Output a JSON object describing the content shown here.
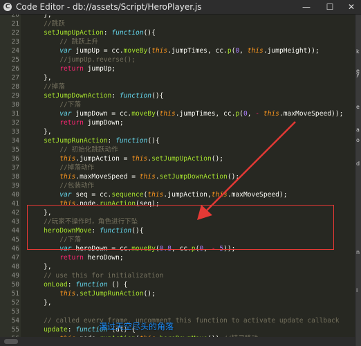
{
  "window": {
    "title": "Code Editor - db://assets/Script/HeroPlayer.js",
    "app_icon_glyph": "C",
    "minimize_glyph": "—",
    "maximize_glyph": "☐",
    "close_glyph": "✕"
  },
  "code": {
    "lines": [
      {
        "n": "20",
        "segs": [
          [
            "pl",
            "    },"
          ]
        ]
      },
      {
        "n": "21",
        "segs": [
          [
            "c",
            "    //跳跃"
          ]
        ]
      },
      {
        "n": "22",
        "segs": [
          [
            "pl",
            "    "
          ],
          [
            "fn",
            "setJumpUpAction"
          ],
          [
            "pl",
            ": "
          ],
          [
            "k",
            "function"
          ],
          [
            "pl",
            "(){"
          ]
        ]
      },
      {
        "n": "23",
        "segs": [
          [
            "c",
            "        // 跳跃上升"
          ]
        ]
      },
      {
        "n": "24",
        "segs": [
          [
            "pl",
            "        "
          ],
          [
            "k",
            "var"
          ],
          [
            "pl",
            " jumpUp = cc."
          ],
          [
            "fn",
            "moveBy"
          ],
          [
            "pl",
            "("
          ],
          [
            "t",
            "this"
          ],
          [
            "pl",
            ".jumpTimes, cc."
          ],
          [
            "fn",
            "p"
          ],
          [
            "pl",
            "("
          ],
          [
            "n",
            "0"
          ],
          [
            "pl",
            ", "
          ],
          [
            "t",
            "this"
          ],
          [
            "pl",
            ".jumpHeight));"
          ]
        ]
      },
      {
        "n": "25",
        "segs": [
          [
            "c",
            "        //jumpUp.reverse();"
          ]
        ]
      },
      {
        "n": "26",
        "segs": [
          [
            "pl",
            "        "
          ],
          [
            "kw",
            "return"
          ],
          [
            "pl",
            " jumpUp;"
          ]
        ]
      },
      {
        "n": "27",
        "segs": [
          [
            "pl",
            "    },"
          ]
        ]
      },
      {
        "n": "28",
        "segs": [
          [
            "c",
            "    //掉落"
          ]
        ]
      },
      {
        "n": "29",
        "segs": [
          [
            "pl",
            "    "
          ],
          [
            "fn",
            "setJumpDownAction"
          ],
          [
            "pl",
            ": "
          ],
          [
            "k",
            "function"
          ],
          [
            "pl",
            "(){"
          ]
        ]
      },
      {
        "n": "30",
        "segs": [
          [
            "c",
            "        //下落"
          ]
        ]
      },
      {
        "n": "31",
        "segs": [
          [
            "pl",
            "        "
          ],
          [
            "k",
            "var"
          ],
          [
            "pl",
            " jumpDown = cc."
          ],
          [
            "fn",
            "moveBy"
          ],
          [
            "pl",
            "("
          ],
          [
            "t",
            "this"
          ],
          [
            "pl",
            ".jumpTimes, cc."
          ],
          [
            "fn",
            "p"
          ],
          [
            "pl",
            "("
          ],
          [
            "n",
            "0"
          ],
          [
            "pl",
            ", "
          ],
          [
            "kw",
            "-"
          ],
          [
            "pl",
            " "
          ],
          [
            "t",
            "this"
          ],
          [
            "pl",
            ".maxMoveSpeed));"
          ]
        ]
      },
      {
        "n": "32",
        "segs": [
          [
            "pl",
            "        "
          ],
          [
            "kw",
            "return"
          ],
          [
            "pl",
            " jumpDown;"
          ]
        ]
      },
      {
        "n": "33",
        "segs": [
          [
            "pl",
            "    },"
          ]
        ]
      },
      {
        "n": "34",
        "segs": [
          [
            "pl",
            "    "
          ],
          [
            "fn",
            "setJumpRunAction"
          ],
          [
            "pl",
            ": "
          ],
          [
            "k",
            "function"
          ],
          [
            "pl",
            "(){"
          ]
        ]
      },
      {
        "n": "35",
        "segs": [
          [
            "c",
            "        // 初始化跳跃动作"
          ]
        ]
      },
      {
        "n": "36",
        "segs": [
          [
            "pl",
            "        "
          ],
          [
            "t",
            "this"
          ],
          [
            "pl",
            ".jumpAction = "
          ],
          [
            "t",
            "this"
          ],
          [
            "pl",
            "."
          ],
          [
            "fn",
            "setJumpUpAction"
          ],
          [
            "pl",
            "();"
          ]
        ]
      },
      {
        "n": "37",
        "segs": [
          [
            "c",
            "        //掉落动作"
          ]
        ]
      },
      {
        "n": "38",
        "segs": [
          [
            "pl",
            "        "
          ],
          [
            "t",
            "this"
          ],
          [
            "pl",
            ".maxMoveSpeed = "
          ],
          [
            "t",
            "this"
          ],
          [
            "pl",
            "."
          ],
          [
            "fn",
            "setJumpDownAction"
          ],
          [
            "pl",
            "();"
          ]
        ]
      },
      {
        "n": "39",
        "segs": [
          [
            "c",
            "        //包装动作"
          ]
        ]
      },
      {
        "n": "40",
        "segs": [
          [
            "pl",
            "        "
          ],
          [
            "k",
            "var"
          ],
          [
            "pl",
            " seq = cc."
          ],
          [
            "fn",
            "sequence"
          ],
          [
            "pl",
            "("
          ],
          [
            "t",
            "this"
          ],
          [
            "pl",
            ".jumpAction,"
          ],
          [
            "t",
            "this"
          ],
          [
            "pl",
            ".maxMoveSpeed);"
          ]
        ]
      },
      {
        "n": "41",
        "segs": [
          [
            "pl",
            "        "
          ],
          [
            "t",
            "this"
          ],
          [
            "pl",
            ".node."
          ],
          [
            "fn",
            "runAction"
          ],
          [
            "pl",
            "(seq);"
          ]
        ]
      },
      {
        "n": "42",
        "segs": [
          [
            "pl",
            "    },"
          ]
        ]
      },
      {
        "n": "43",
        "segs": [
          [
            "c",
            "    //玩家不操作时，角色进行下坠"
          ]
        ]
      },
      {
        "n": "44",
        "segs": [
          [
            "pl",
            "    "
          ],
          [
            "fn",
            "heroDownMove"
          ],
          [
            "pl",
            ": "
          ],
          [
            "k",
            "function"
          ],
          [
            "pl",
            "(){"
          ]
        ]
      },
      {
        "n": "45",
        "segs": [
          [
            "c",
            "        //下落"
          ]
        ]
      },
      {
        "n": "46",
        "segs": [
          [
            "pl",
            "        "
          ],
          [
            "k",
            "var"
          ],
          [
            "pl",
            " heroDown = cc."
          ],
          [
            "fn",
            "moveBy"
          ],
          [
            "pl",
            "("
          ],
          [
            "n",
            "0.8"
          ],
          [
            "pl",
            ", cc."
          ],
          [
            "fn",
            "p"
          ],
          [
            "pl",
            "("
          ],
          [
            "n",
            "0"
          ],
          [
            "pl",
            ", "
          ],
          [
            "kw",
            "-"
          ],
          [
            "pl",
            " "
          ],
          [
            "n",
            "5"
          ],
          [
            "pl",
            "));"
          ]
        ]
      },
      {
        "n": "47",
        "segs": [
          [
            "pl",
            "        "
          ],
          [
            "kw",
            "return"
          ],
          [
            "pl",
            " heroDown;"
          ]
        ]
      },
      {
        "n": "48",
        "segs": [
          [
            "pl",
            "    },"
          ]
        ]
      },
      {
        "n": "49",
        "segs": [
          [
            "c",
            "    // use this for initialization"
          ]
        ]
      },
      {
        "n": "50",
        "segs": [
          [
            "pl",
            "    "
          ],
          [
            "fn",
            "onLoad"
          ],
          [
            "pl",
            ": "
          ],
          [
            "k",
            "function"
          ],
          [
            "pl",
            " () {"
          ]
        ]
      },
      {
        "n": "51",
        "segs": [
          [
            "pl",
            "        "
          ],
          [
            "t",
            "this"
          ],
          [
            "pl",
            "."
          ],
          [
            "fn",
            "setJumpRunAction"
          ],
          [
            "pl",
            "();"
          ]
        ]
      },
      {
        "n": "52",
        "segs": [
          [
            "pl",
            "    },"
          ]
        ]
      },
      {
        "n": "53",
        "segs": [
          [
            "pl",
            ""
          ]
        ]
      },
      {
        "n": "54",
        "segs": [
          [
            "c",
            "    // called every frame, uncomment this function to activate update callback"
          ]
        ]
      },
      {
        "n": "55",
        "segs": [
          [
            "pl",
            "    "
          ],
          [
            "fn",
            "update"
          ],
          [
            "pl",
            ": "
          ],
          [
            "k",
            "function"
          ],
          [
            "pl",
            " (dt) {"
          ]
        ]
      },
      {
        "n": "56",
        "segs": [
          [
            "pl",
            "        "
          ],
          [
            "t",
            "this"
          ],
          [
            "pl",
            ".node."
          ],
          [
            "fn",
            "runAction"
          ],
          [
            "pl",
            "("
          ],
          [
            "t",
            "this"
          ],
          [
            "pl",
            "."
          ],
          [
            "fn",
            "heroDownMove"
          ],
          [
            "pl",
            "());"
          ],
          [
            "c",
            "//精灵移动"
          ]
        ]
      },
      {
        "n": "57",
        "segs": [
          [
            "pl",
            "    },"
          ]
        ]
      },
      {
        "n": "58",
        "segs": [
          [
            "pl",
            "});"
          ]
        ]
      }
    ]
  },
  "overlay": {
    "subtitle": "漫过天空尽头的角落"
  },
  "side_fragments": [
    "k",
    "e",
    "y",
    "e",
    "a",
    "o",
    "d",
    "n",
    "i"
  ]
}
